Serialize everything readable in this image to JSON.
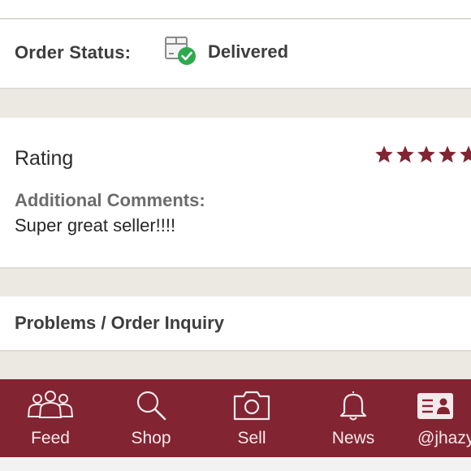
{
  "order": {
    "status_label": "Order Status:",
    "status_value": "Delivered",
    "status_icon": "delivered-box-icon",
    "status_icon_color": "#2eaa4e"
  },
  "rating": {
    "title": "Rating",
    "stars_visible": 5,
    "star_color": "#822432",
    "comments_label": "Additional Comments:",
    "comments_text": "Super great seller!!!!"
  },
  "inquiry": {
    "label": "Problems / Order Inquiry"
  },
  "nav": {
    "background": "#822432",
    "items": [
      {
        "label": "Feed",
        "icon": "people-icon"
      },
      {
        "label": "Shop",
        "icon": "search-icon"
      },
      {
        "label": "Sell",
        "icon": "camera-icon"
      },
      {
        "label": "News",
        "icon": "bell-icon"
      },
      {
        "label": "@jhazy",
        "icon": "profile-card-icon"
      }
    ]
  }
}
